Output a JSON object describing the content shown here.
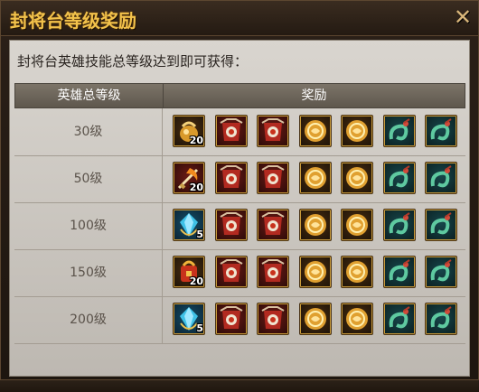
{
  "dialog": {
    "title": "封将台等级奖励",
    "close_glyph": "✕",
    "description": "封将台英雄技能总等级达到即可获得："
  },
  "table": {
    "col_level": "英雄总等级",
    "col_reward": "奖励",
    "rows": [
      {
        "level": "30级",
        "first_item": {
          "icon": "gold-pouch-icon",
          "count": "20",
          "tone": "gold"
        }
      },
      {
        "level": "50级",
        "first_item": {
          "icon": "flaming-sword-icon",
          "count": "20",
          "tone": "red"
        }
      },
      {
        "level": "100级",
        "first_item": {
          "icon": "blue-crystal-icon",
          "count": "5",
          "tone": "blue"
        }
      },
      {
        "level": "150级",
        "first_item": {
          "icon": "red-bag-icon",
          "count": "20",
          "tone": "gold"
        }
      },
      {
        "level": "200级",
        "first_item": {
          "icon": "blue-crystal-icon",
          "count": "5",
          "tone": "blue"
        }
      }
    ],
    "common_items": [
      {
        "icon": "red-armor-icon",
        "tone": "red"
      },
      {
        "icon": "red-armor-icon",
        "tone": "red"
      },
      {
        "icon": "gold-coin-icon",
        "tone": "gold"
      },
      {
        "icon": "gold-coin-icon",
        "tone": "gold"
      },
      {
        "icon": "jade-dragon-icon",
        "tone": "teal"
      },
      {
        "icon": "jade-dragon-icon",
        "tone": "teal"
      }
    ]
  }
}
